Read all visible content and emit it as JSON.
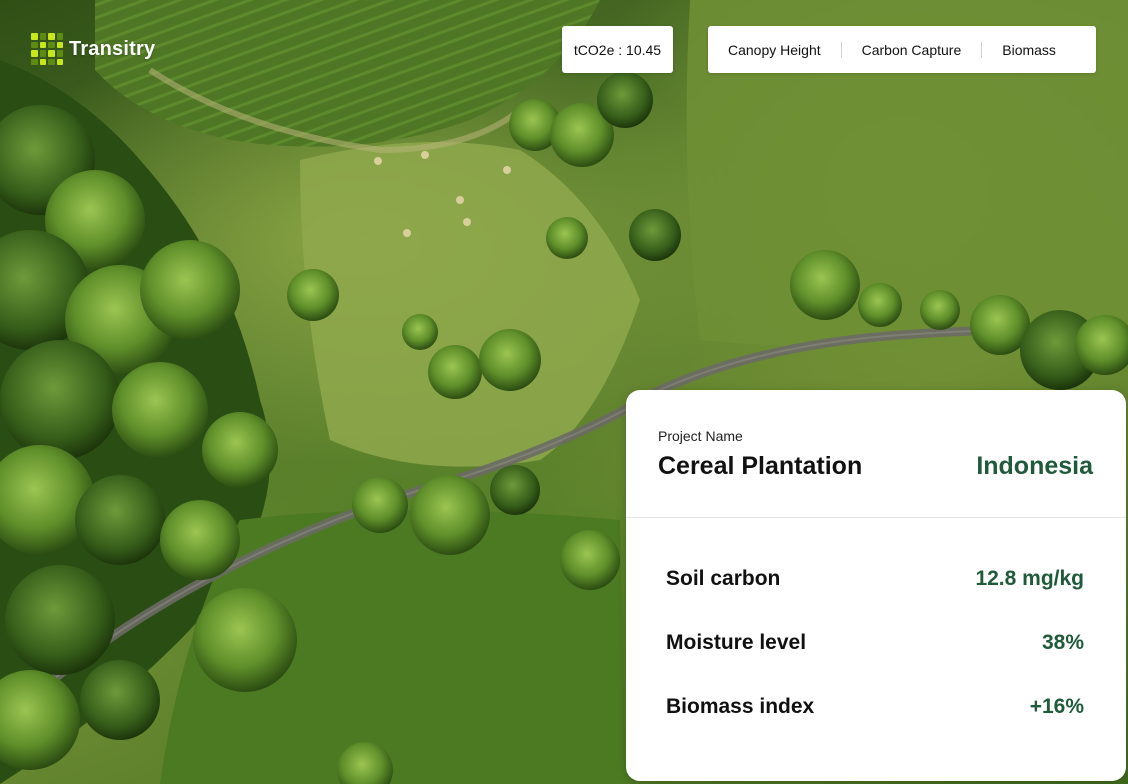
{
  "app": {
    "brand": "Transitry"
  },
  "header": {
    "co2_chip": "tCO2e : 10.45",
    "layers": [
      {
        "label": "Canopy Height"
      },
      {
        "label": "Carbon Capture"
      },
      {
        "label": "Biomass"
      }
    ]
  },
  "project_card": {
    "label": "Project Name",
    "name": "Cereal Plantation",
    "country": "Indonesia",
    "metrics": [
      {
        "label": "Soil carbon",
        "value": "12.8 mg/kg"
      },
      {
        "label": "Moisture level",
        "value": "38%"
      },
      {
        "label": "Biomass index",
        "value": "+16%"
      }
    ]
  },
  "colors": {
    "brand_lime": "#c8e61c",
    "accent_green": "#1f5a3a",
    "card_bg": "#ffffff"
  }
}
